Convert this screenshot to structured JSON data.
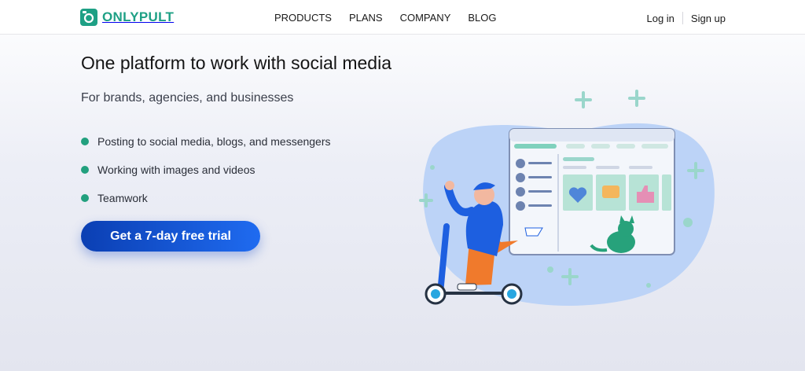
{
  "brand": {
    "name": "ONLYPULT",
    "color": "#1ea085"
  },
  "nav": {
    "items": [
      "PRODUCTS",
      "PLANS",
      "COMPANY",
      "BLOG"
    ]
  },
  "auth": {
    "login": "Log in",
    "signup": "Sign up"
  },
  "hero": {
    "title": "One platform to work with social media",
    "subtitle": "For brands, agencies, and businesses",
    "features": [
      "Posting to social media, blogs, and messengers",
      "Working with images and videos",
      "Teamwork"
    ],
    "cta": "Get a 7-day free trial"
  },
  "colors": {
    "accent": "#1ea085",
    "cta_start": "#0b3fb3",
    "cta_end": "#1f6bf0",
    "bullet": "#22a07e"
  },
  "illustration": {
    "name": "person-on-scooter-with-dashboard"
  }
}
